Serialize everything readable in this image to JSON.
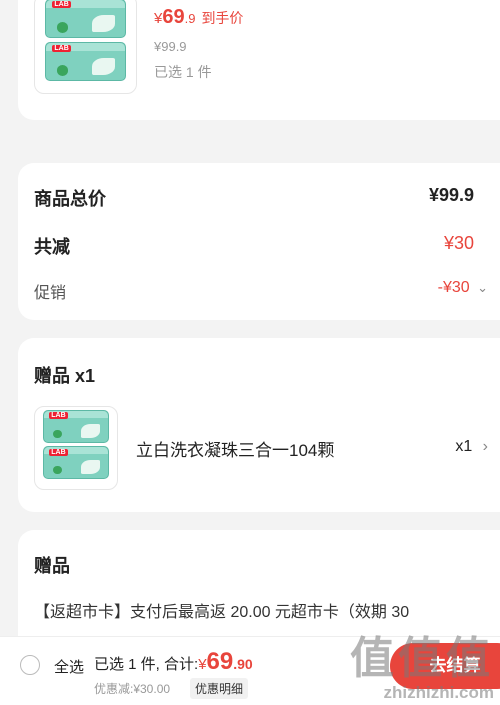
{
  "product": {
    "price_symbol": "¥",
    "price_int": "69",
    "price_dec": ".9",
    "price_tag": "到手价",
    "original_price": "¥99.9",
    "selected_count": "已选 1 件"
  },
  "summary": {
    "total_label": "商品总价",
    "total_value": "¥99.9",
    "reduce_label": "共减",
    "reduce_value": "¥30",
    "promo_label": "促销",
    "promo_value": "-¥30"
  },
  "gift_item": {
    "title": "赠品 x1",
    "name": "立白洗衣凝珠三合一104颗",
    "qty": "x1"
  },
  "gift_info": {
    "title": "赠品",
    "text": "【返超市卡】支付后最高返 20.00 元超市卡（效期 30"
  },
  "bottom_bar": {
    "select_all": "全选",
    "selected_total_prefix": "已选 1 件, 合计:",
    "total_symbol": "¥",
    "total_int": "69",
    "total_dec": ".90",
    "discount_text": "优惠减:¥30.00",
    "discount_detail": "优惠明细",
    "checkout": "去结算"
  },
  "watermark": {
    "big": "值值值",
    "small": "zhizhizhi.com"
  },
  "colors": {
    "accent": "#e8453c",
    "background": "#f3f3f3"
  },
  "icons": {
    "promo_chevron": "chevron-down-icon",
    "gift_chevron": "chevron-right-icon"
  }
}
